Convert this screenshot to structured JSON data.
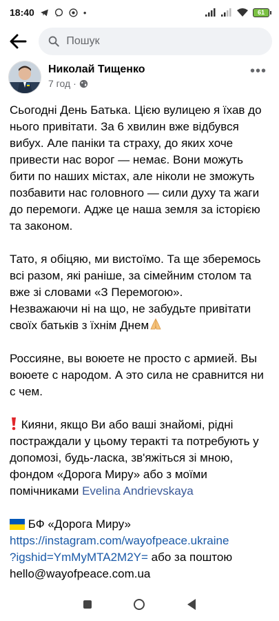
{
  "status_bar": {
    "time": "18:40",
    "battery": "61"
  },
  "search": {
    "placeholder": "Пошук"
  },
  "post": {
    "author": "Николай Тищенко",
    "time_ago": "7 год",
    "paragraphs": [
      "Сьогодні День Батька. Цією вулицею я їхав до нього привітати. За 6 хвилин вже відбувся вибух. Але паніки та страху, до яких хоче привести нас ворог — немає. Вони можуть бити по наших містах, але ніколи не зможуть позбавити нас головного — сили духу та жаги до перемоги. Адже це наша земля за історією та законом.",
      "Тато, я обіцяю, ми вистоїмо. Та ще зберемось всі разом, які раніше, за сімейним столом та вже зі словами «З Перемогою».",
      "Незважаючи ні на що, не забудьте привітати своїх батьків з їхнім Днем",
      "Россияне, вы воюете не просто с армией. Вы воюете с народом. А это сила не сравнится ни с чем.",
      "Кияни, якщо Ви або ваші знайомі, рідні постраждали у цьому теракті та потребують у допомозі, будь-ласка, зв'яжіться зі мною, фондом «Дорога Миру» або з моїми помічниками",
      "БФ «Дорога Миру»",
      "або за поштою"
    ],
    "mention": "Evelina Andrievskaya",
    "link_part1": "https://instagram.com/wayofpeace.ukraine",
    "link_part2": "?igshid=YmMyMTA2M2Y=",
    "email": "hello@wayofpeace.com.ua"
  },
  "colors": {
    "link": "#1b5aa8",
    "mention": "#385898",
    "search_bg": "#f0f2f5"
  },
  "icons": [
    "back-arrow-icon",
    "search-icon",
    "globe-icon",
    "more-icon",
    "folded-hands-emoji",
    "exclamation-emoji",
    "ukraine-flag-emoji"
  ]
}
